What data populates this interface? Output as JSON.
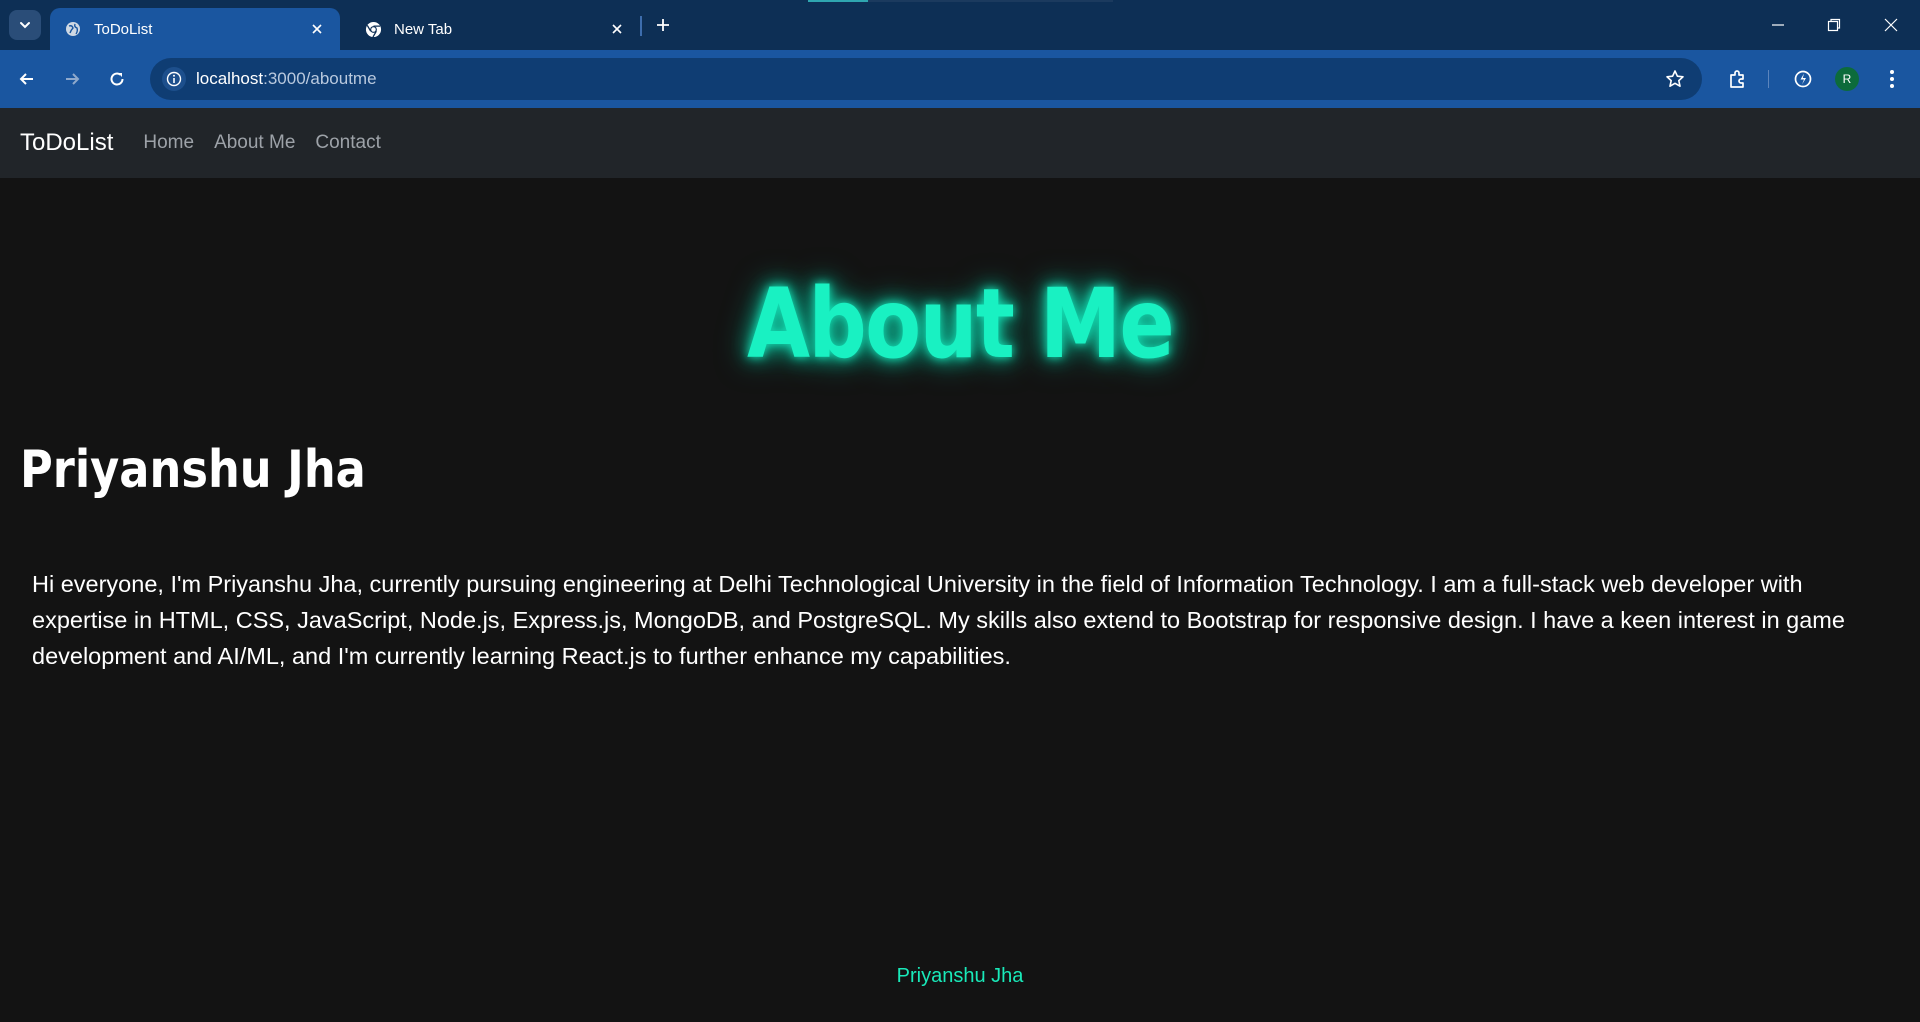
{
  "browser": {
    "tabs": [
      {
        "title": "ToDoList",
        "active": true,
        "icon": "globe-icon"
      },
      {
        "title": "New Tab",
        "active": false,
        "icon": "chrome-icon"
      }
    ],
    "url": {
      "host": "localhost",
      "path": ":3000/aboutme"
    },
    "profile_initial": "R",
    "colors": {
      "tabstrip": "#0d2f55",
      "toolbar": "#1a56a0",
      "omnibox": "#0f3d73"
    }
  },
  "navbar": {
    "brand": "ToDoList",
    "links": [
      "Home",
      "About Me",
      "Contact"
    ]
  },
  "page": {
    "heading": "About Me",
    "name": "Priyanshu Jha",
    "bio": "Hi everyone, I'm Priyanshu Jha, currently pursuing engineering at Delhi Technological University in the field of Information Technology. I am a full-stack web developer with expertise in HTML, CSS, JavaScript, Node.js, Express.js, MongoDB, and PostgreSQL. My skills also extend to Bootstrap for responsive design. I have a keen interest in game development and AI/ML, and I'm currently learning React.js to further enhance my capabilities.",
    "footer": "Priyanshu Jha",
    "colors": {
      "accent": "#19f1c2",
      "background": "#131313",
      "navbar": "#212529"
    }
  }
}
